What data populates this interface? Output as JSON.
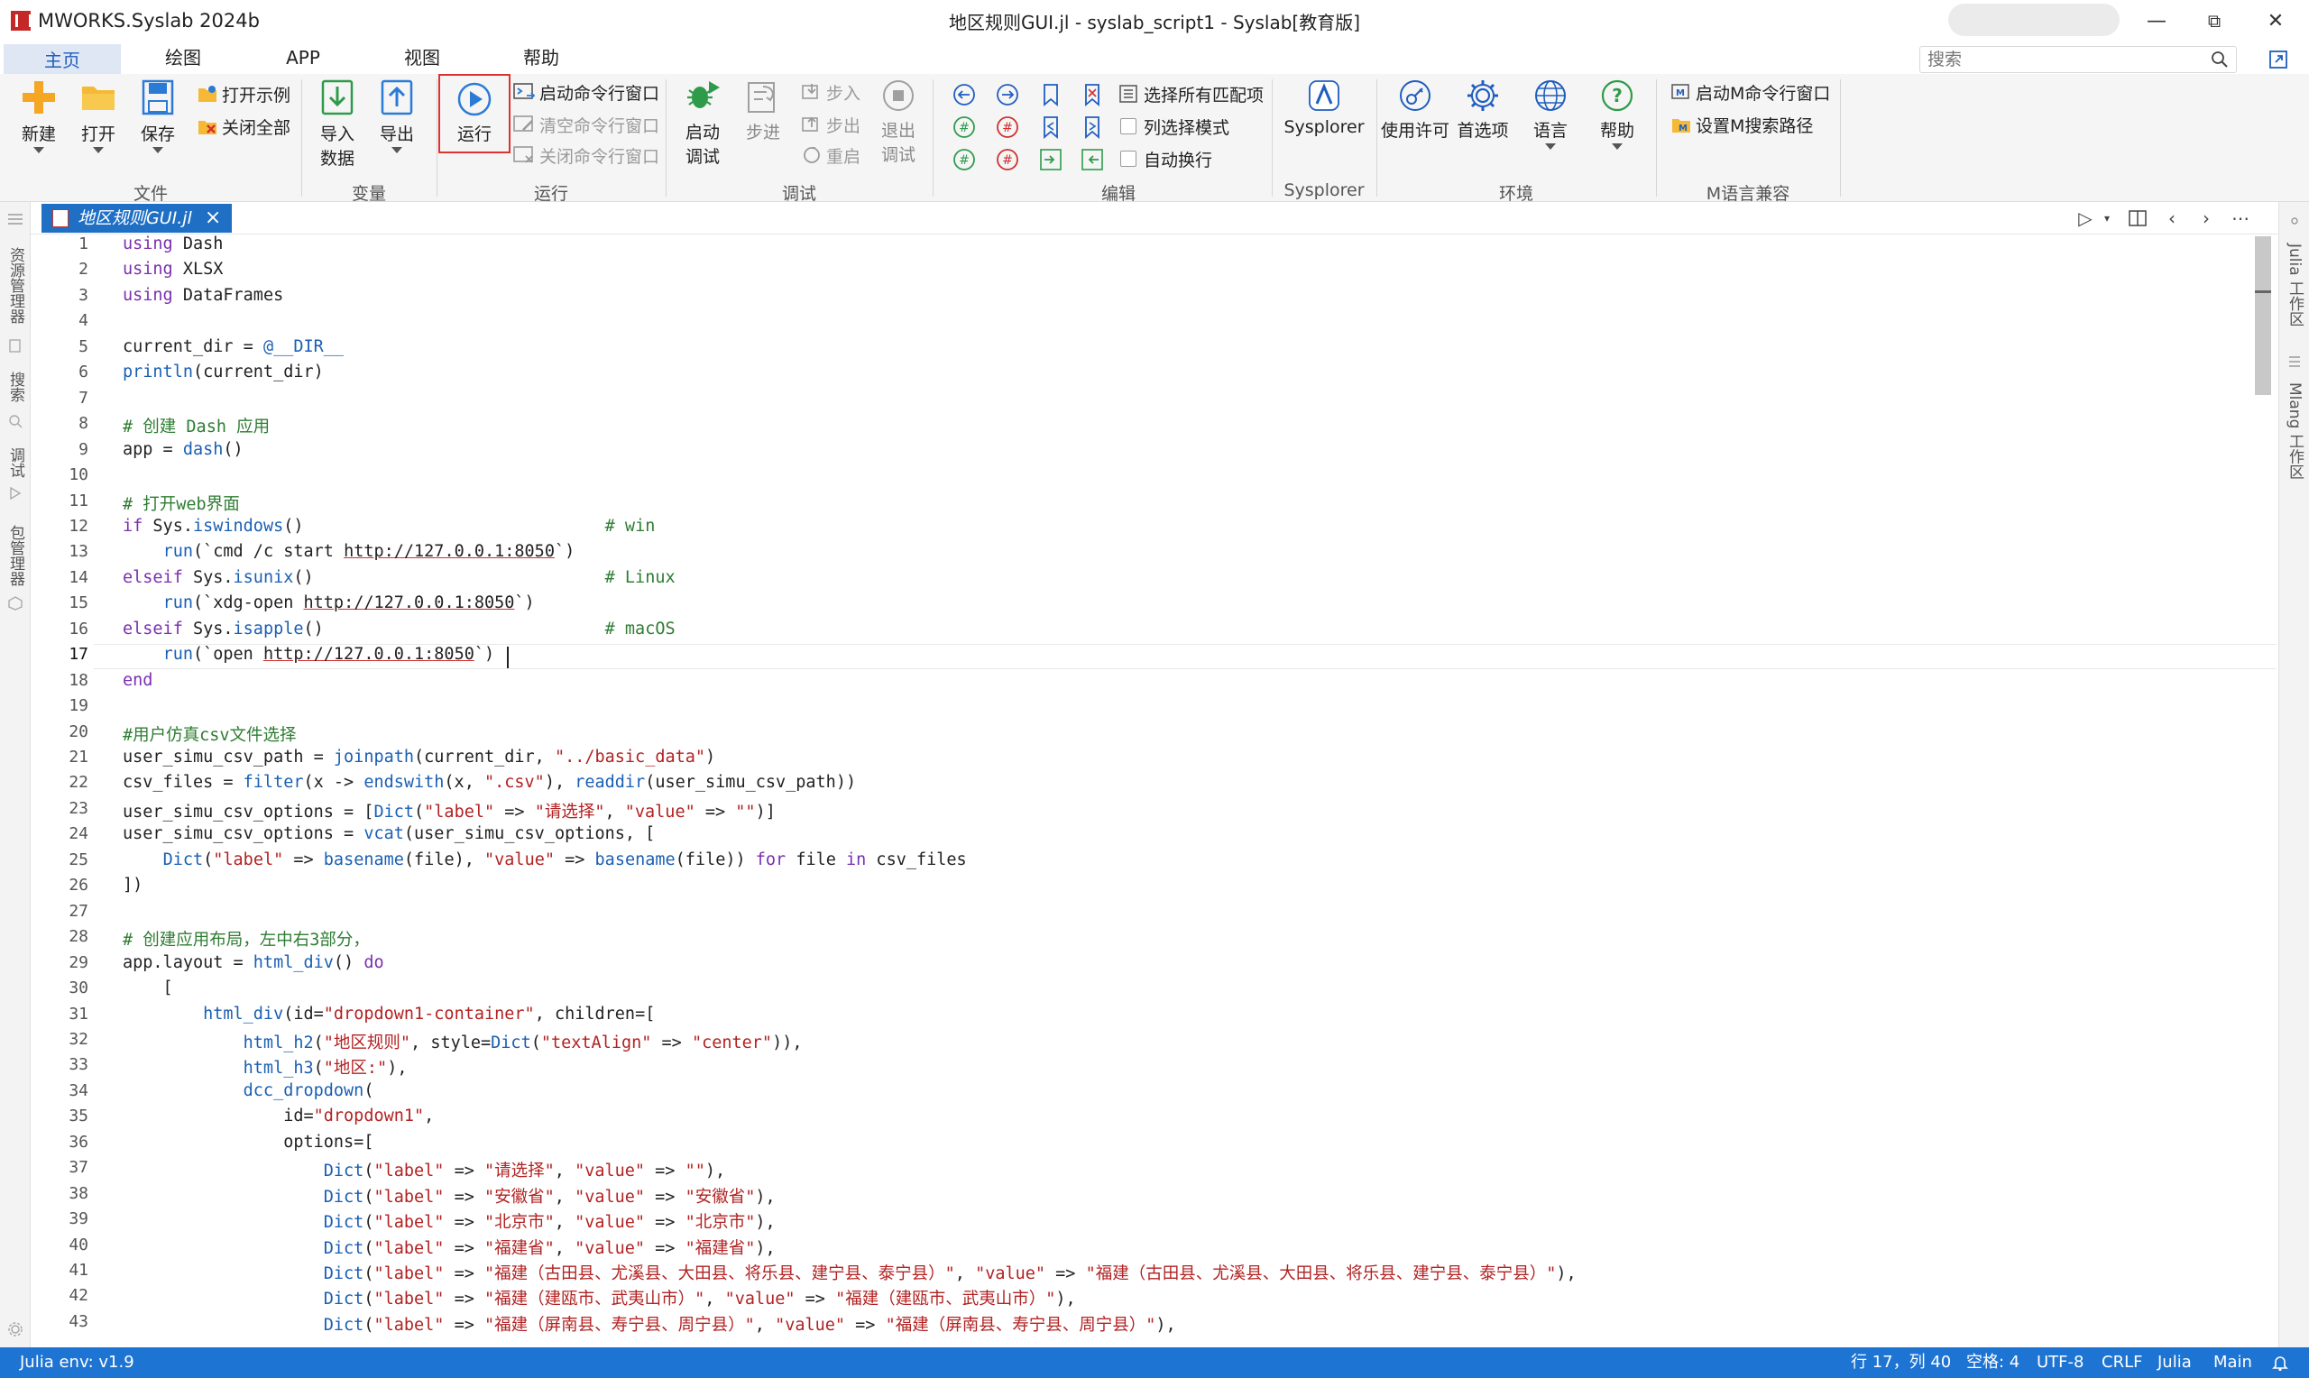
{
  "titlebar": {
    "app_name": "MWORKS.Syslab 2024b",
    "window_title": "地区规则GUI.jl - syslab_script1 - Syslab[教育版]",
    "minimize": "—",
    "maximize": "⧉",
    "close": "✕"
  },
  "menu": {
    "tabs": [
      "主页",
      "绘图",
      "APP",
      "视图",
      "帮助"
    ],
    "active": "主页",
    "search_placeholder": "搜索"
  },
  "ribbon": {
    "groups": {
      "file": "文件",
      "variable": "变量",
      "run": "运行",
      "debug": "调试",
      "edit": "编辑",
      "sysplorer": "Sysplorer",
      "env": "环境",
      "mlang": "M语言兼容"
    },
    "file": {
      "new": "新建",
      "open": "打开",
      "save": "保存",
      "open_example": "打开示例",
      "close_all": "关闭全部"
    },
    "variable": {
      "import": [
        "导入",
        "数据"
      ],
      "export": "导出"
    },
    "run": {
      "run": "运行",
      "start_cmd": "启动命令行窗口",
      "clear_cmd": "清空命令行窗口",
      "close_cmd": "关闭命令行窗口"
    },
    "debug": {
      "start_debug": [
        "启动",
        "调试"
      ],
      "step": "步进",
      "step_in": "步入",
      "step_out": "步出",
      "restart": "重启",
      "exit_debug": [
        "退出",
        "调试"
      ]
    },
    "edit": {
      "select_all_matches": "选择所有匹配项",
      "column_select": "列选择模式",
      "auto_wrap": "自动换行"
    },
    "sysplorer": {
      "label": "Sysplorer"
    },
    "env": {
      "license": "使用许可",
      "preferences": "首选项",
      "language": "语言",
      "help": "帮助"
    },
    "mlang": {
      "start_m_cmd": "启动M命令行窗口",
      "set_m_path": "设置M搜索路径"
    }
  },
  "leftbar": {
    "items": [
      "资源管理器",
      "搜索",
      "调试",
      "包管理器"
    ]
  },
  "rightbar": {
    "items": [
      "Julia 工作区",
      "Mlang 工作区"
    ]
  },
  "editor": {
    "file_tab": "地区规则GUI.jl",
    "current_line": 17,
    "lines": [
      [
        [
          "kw",
          "using"
        ],
        [
          "pl",
          " Dash"
        ]
      ],
      [
        [
          "kw",
          "using"
        ],
        [
          "pl",
          " XLSX"
        ]
      ],
      [
        [
          "kw",
          "using"
        ],
        [
          "pl",
          " DataFrames"
        ]
      ],
      [],
      [
        [
          "pl",
          "current_dir = "
        ],
        [
          "fn",
          "@__DIR__"
        ]
      ],
      [
        [
          "fn",
          "println"
        ],
        [
          "pl",
          "(current_dir)"
        ]
      ],
      [],
      [
        [
          "cm",
          "# 创建 Dash 应用"
        ]
      ],
      [
        [
          "pl",
          "app = "
        ],
        [
          "fn",
          "dash"
        ],
        [
          "pl",
          "()"
        ]
      ],
      [],
      [
        [
          "cm",
          "# 打开web界面"
        ]
      ],
      [
        [
          "kw",
          "if"
        ],
        [
          "pl",
          " Sys."
        ],
        [
          "fn",
          "iswindows"
        ],
        [
          "pl",
          "()                              "
        ],
        [
          "cm",
          "# win"
        ]
      ],
      [
        [
          "pl",
          "    "
        ],
        [
          "fn",
          "run"
        ],
        [
          "pl",
          "(`cmd /c start "
        ],
        [
          "url",
          "http://127.0.0.1:8050"
        ],
        [
          "pl",
          "`)"
        ]
      ],
      [
        [
          "kw",
          "elseif"
        ],
        [
          "pl",
          " Sys."
        ],
        [
          "fn",
          "isunix"
        ],
        [
          "pl",
          "()                             "
        ],
        [
          "cm",
          "# Linux"
        ]
      ],
      [
        [
          "pl",
          "    "
        ],
        [
          "fn",
          "run"
        ],
        [
          "pl",
          "(`xdg-open "
        ],
        [
          "url",
          "http://127.0.0.1:8050"
        ],
        [
          "pl",
          "`)"
        ]
      ],
      [
        [
          "kw",
          "elseif"
        ],
        [
          "pl",
          " Sys."
        ],
        [
          "fn",
          "isapple"
        ],
        [
          "pl",
          "()                            "
        ],
        [
          "cm",
          "# macOS"
        ]
      ],
      [
        [
          "pl",
          "    "
        ],
        [
          "fn",
          "run"
        ],
        [
          "pl",
          "(`open "
        ],
        [
          "url",
          "http://127.0.0.1:8050"
        ],
        [
          "pl",
          "`)"
        ]
      ],
      [
        [
          "kw",
          "end"
        ]
      ],
      [],
      [
        [
          "cm",
          "#用户仿真csv文件选择"
        ]
      ],
      [
        [
          "pl",
          "user_simu_csv_path = "
        ],
        [
          "fn",
          "joinpath"
        ],
        [
          "pl",
          "(current_dir, "
        ],
        [
          "str",
          "\"../basic_data\""
        ],
        [
          "pl",
          ")"
        ]
      ],
      [
        [
          "pl",
          "csv_files = "
        ],
        [
          "fn",
          "filter"
        ],
        [
          "pl",
          "(x -> "
        ],
        [
          "fn",
          "endswith"
        ],
        [
          "pl",
          "(x, "
        ],
        [
          "str",
          "\".csv\""
        ],
        [
          "pl",
          "), "
        ],
        [
          "fn",
          "readdir"
        ],
        [
          "pl",
          "(user_simu_csv_path))"
        ]
      ],
      [
        [
          "pl",
          "user_simu_csv_options = ["
        ],
        [
          "fn",
          "Dict"
        ],
        [
          "pl",
          "("
        ],
        [
          "str",
          "\"label\""
        ],
        [
          "pl",
          " => "
        ],
        [
          "str",
          "\"请选择\""
        ],
        [
          "pl",
          ", "
        ],
        [
          "str",
          "\"value\""
        ],
        [
          "pl",
          " => "
        ],
        [
          "str",
          "\"\""
        ],
        [
          "pl",
          ")]"
        ]
      ],
      [
        [
          "pl",
          "user_simu_csv_options = "
        ],
        [
          "fn",
          "vcat"
        ],
        [
          "pl",
          "(user_simu_csv_options, ["
        ]
      ],
      [
        [
          "pl",
          "    "
        ],
        [
          "fn",
          "Dict"
        ],
        [
          "pl",
          "("
        ],
        [
          "str",
          "\"label\""
        ],
        [
          "pl",
          " => "
        ],
        [
          "fn",
          "basename"
        ],
        [
          "pl",
          "(file), "
        ],
        [
          "str",
          "\"value\""
        ],
        [
          "pl",
          " => "
        ],
        [
          "fn",
          "basename"
        ],
        [
          "pl",
          "(file)) "
        ],
        [
          "kw",
          "for"
        ],
        [
          "pl",
          " file "
        ],
        [
          "kw",
          "in"
        ],
        [
          "pl",
          " csv_files"
        ]
      ],
      [
        [
          "pl",
          "])"
        ]
      ],
      [],
      [
        [
          "cm",
          "# 创建应用布局，左中右3部分，"
        ]
      ],
      [
        [
          "pl",
          "app.layout = "
        ],
        [
          "fn",
          "html_div"
        ],
        [
          "pl",
          "() "
        ],
        [
          "kw",
          "do"
        ]
      ],
      [
        [
          "pl",
          "    ["
        ]
      ],
      [
        [
          "pl",
          "        "
        ],
        [
          "fn",
          "html_div"
        ],
        [
          "pl",
          "(id="
        ],
        [
          "str",
          "\"dropdown1-container\""
        ],
        [
          "pl",
          ", children=["
        ]
      ],
      [
        [
          "pl",
          "            "
        ],
        [
          "fn",
          "html_h2"
        ],
        [
          "pl",
          "("
        ],
        [
          "str",
          "\"地区规则\""
        ],
        [
          "pl",
          ", style="
        ],
        [
          "fn",
          "Dict"
        ],
        [
          "pl",
          "("
        ],
        [
          "str",
          "\"textAlign\""
        ],
        [
          "pl",
          " => "
        ],
        [
          "str",
          "\"center\""
        ],
        [
          "pl",
          ")),"
        ]
      ],
      [
        [
          "pl",
          "            "
        ],
        [
          "fn",
          "html_h3"
        ],
        [
          "pl",
          "("
        ],
        [
          "str",
          "\"地区:\""
        ],
        [
          "pl",
          "),"
        ]
      ],
      [
        [
          "pl",
          "            "
        ],
        [
          "fn",
          "dcc_dropdown"
        ],
        [
          "pl",
          "("
        ]
      ],
      [
        [
          "pl",
          "                id="
        ],
        [
          "str",
          "\"dropdown1\""
        ],
        [
          "pl",
          ","
        ]
      ],
      [
        [
          "pl",
          "                options=["
        ]
      ],
      [
        [
          "pl",
          "                    "
        ],
        [
          "fn",
          "Dict"
        ],
        [
          "pl",
          "("
        ],
        [
          "str",
          "\"label\""
        ],
        [
          "pl",
          " => "
        ],
        [
          "str",
          "\"请选择\""
        ],
        [
          "pl",
          ", "
        ],
        [
          "str",
          "\"value\""
        ],
        [
          "pl",
          " => "
        ],
        [
          "str",
          "\"\""
        ],
        [
          "pl",
          "),"
        ]
      ],
      [
        [
          "pl",
          "                    "
        ],
        [
          "fn",
          "Dict"
        ],
        [
          "pl",
          "("
        ],
        [
          "str",
          "\"label\""
        ],
        [
          "pl",
          " => "
        ],
        [
          "str",
          "\"安徽省\""
        ],
        [
          "pl",
          ", "
        ],
        [
          "str",
          "\"value\""
        ],
        [
          "pl",
          " => "
        ],
        [
          "str",
          "\"安徽省\""
        ],
        [
          "pl",
          "),"
        ]
      ],
      [
        [
          "pl",
          "                    "
        ],
        [
          "fn",
          "Dict"
        ],
        [
          "pl",
          "("
        ],
        [
          "str",
          "\"label\""
        ],
        [
          "pl",
          " => "
        ],
        [
          "str",
          "\"北京市\""
        ],
        [
          "pl",
          ", "
        ],
        [
          "str",
          "\"value\""
        ],
        [
          "pl",
          " => "
        ],
        [
          "str",
          "\"北京市\""
        ],
        [
          "pl",
          "),"
        ]
      ],
      [
        [
          "pl",
          "                    "
        ],
        [
          "fn",
          "Dict"
        ],
        [
          "pl",
          "("
        ],
        [
          "str",
          "\"label\""
        ],
        [
          "pl",
          " => "
        ],
        [
          "str",
          "\"福建省\""
        ],
        [
          "pl",
          ", "
        ],
        [
          "str",
          "\"value\""
        ],
        [
          "pl",
          " => "
        ],
        [
          "str",
          "\"福建省\""
        ],
        [
          "pl",
          "),"
        ]
      ],
      [
        [
          "pl",
          "                    "
        ],
        [
          "fn",
          "Dict"
        ],
        [
          "pl",
          "("
        ],
        [
          "str",
          "\"label\""
        ],
        [
          "pl",
          " => "
        ],
        [
          "str",
          "\"福建（古田县、尤溪县、大田县、将乐县、建宁县、泰宁县）\""
        ],
        [
          "pl",
          ", "
        ],
        [
          "str",
          "\"value\""
        ],
        [
          "pl",
          " => "
        ],
        [
          "str",
          "\"福建（古田县、尤溪县、大田县、将乐县、建宁县、泰宁县）\""
        ],
        [
          "pl",
          "),"
        ]
      ],
      [
        [
          "pl",
          "                    "
        ],
        [
          "fn",
          "Dict"
        ],
        [
          "pl",
          "("
        ],
        [
          "str",
          "\"label\""
        ],
        [
          "pl",
          " => "
        ],
        [
          "str",
          "\"福建（建瓯市、武夷山市）\""
        ],
        [
          "pl",
          ", "
        ],
        [
          "str",
          "\"value\""
        ],
        [
          "pl",
          " => "
        ],
        [
          "str",
          "\"福建（建瓯市、武夷山市）\""
        ],
        [
          "pl",
          "),"
        ]
      ],
      [
        [
          "pl",
          "                    "
        ],
        [
          "fn",
          "Dict"
        ],
        [
          "pl",
          "("
        ],
        [
          "str",
          "\"label\""
        ],
        [
          "pl",
          " => "
        ],
        [
          "str",
          "\"福建（屏南县、寿宁县、周宁县）\""
        ],
        [
          "pl",
          ", "
        ],
        [
          "str",
          "\"value\""
        ],
        [
          "pl",
          " => "
        ],
        [
          "str",
          "\"福建（屏南县、寿宁县、周宁县）\""
        ],
        [
          "pl",
          "),"
        ]
      ]
    ]
  },
  "statusbar": {
    "env": "Julia env: v1.9",
    "position": "行 17，列 40",
    "spaces": "空格: 4",
    "encoding": "UTF-8",
    "eol": "CRLF",
    "language": "Julia",
    "branch": "Main"
  },
  "colors": {
    "accent": "#1e74d2",
    "keyword": "#7a2fb0",
    "function": "#1a5fb4",
    "string": "#b22222",
    "comment": "#2e7d32",
    "run_highlight": "#e03131"
  }
}
